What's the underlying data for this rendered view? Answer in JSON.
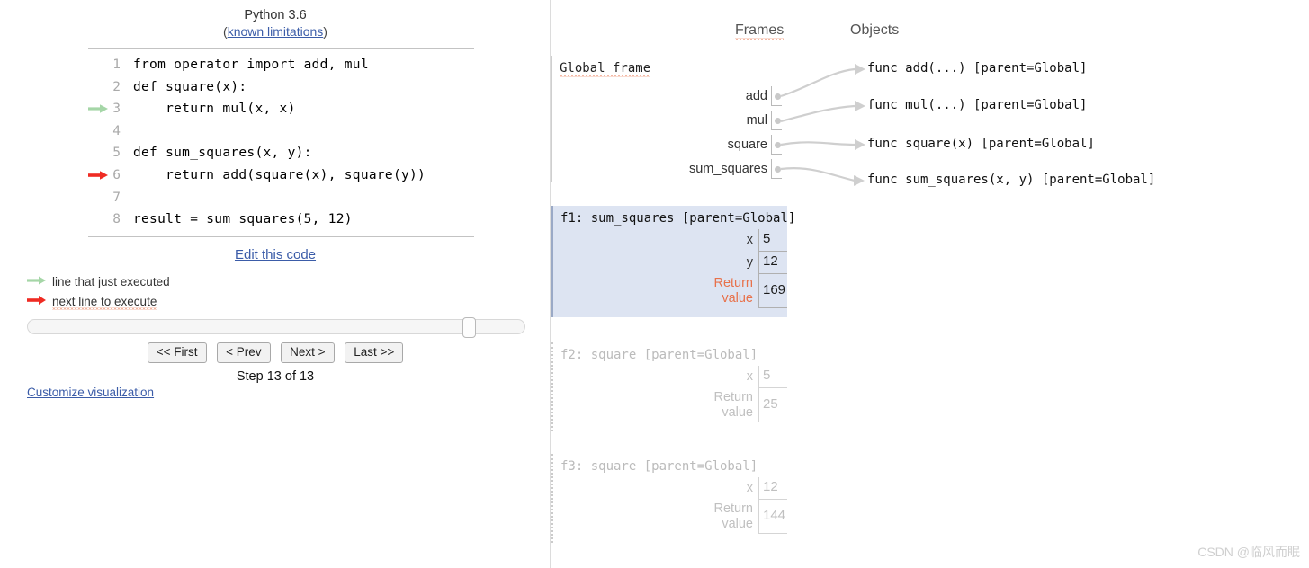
{
  "header": {
    "python_version": "Python 3.6",
    "known_limitations_label": "known limitations",
    "paren_open": "(",
    "paren_close": ")"
  },
  "code": {
    "lines": [
      {
        "number": "1",
        "text": "from operator import add, mul",
        "marker": "none"
      },
      {
        "number": "2",
        "text": "def square(x):",
        "marker": "none"
      },
      {
        "number": "3",
        "text": "    return mul(x, x)",
        "marker": "just-executed"
      },
      {
        "number": "4",
        "text": "",
        "marker": "none"
      },
      {
        "number": "5",
        "text": "def sum_squares(x, y):",
        "marker": "none"
      },
      {
        "number": "6",
        "text": "    return add(square(x), square(y))",
        "marker": "next-to-execute"
      },
      {
        "number": "7",
        "text": "",
        "marker": "none"
      },
      {
        "number": "8",
        "text": "result = sum_squares(5, 12)",
        "marker": "none"
      }
    ]
  },
  "edit_code_label": "Edit this code",
  "legend": {
    "just_executed": "line that just executed",
    "next_to_execute": "next line to execute",
    "green_color": "#a5d6a7",
    "red_color": "#ef2b23"
  },
  "controls": {
    "first_label": "<< First",
    "prev_label": "< Prev",
    "next_label": "Next >",
    "last_label": "Last >>",
    "step_label": "Step 13 of 13",
    "slider_position_percent": 90
  },
  "customize_link_label": "Customize visualization",
  "right": {
    "frames_header": "Frames",
    "objects_header": "Objects",
    "global_frame_label": "Global frame",
    "global_vars": [
      {
        "name": "add"
      },
      {
        "name": "mul"
      },
      {
        "name": "square"
      },
      {
        "name": "sum_squares"
      }
    ],
    "objects": [
      {
        "label": "func add(...) [parent=Global]"
      },
      {
        "label": "func mul(...) [parent=Global]"
      },
      {
        "label": "func square(x) [parent=Global]"
      },
      {
        "label": "func sum_squares(x, y) [parent=Global]"
      }
    ],
    "stack_frames": [
      {
        "title": "f1: sum_squares [parent=Global]",
        "state": "active",
        "vars": [
          {
            "name": "x",
            "value": "5",
            "is_return": false
          },
          {
            "name": "y",
            "value": "12",
            "is_return": false
          },
          {
            "name": "Return\nvalue",
            "value": "169",
            "is_return": true
          }
        ]
      },
      {
        "title": "f2: square [parent=Global]",
        "state": "faded",
        "vars": [
          {
            "name": "x",
            "value": "5",
            "is_return": false
          },
          {
            "name": "Return\nvalue",
            "value": "25",
            "is_return": true
          }
        ]
      },
      {
        "title": "f3: square [parent=Global]",
        "state": "faded",
        "vars": [
          {
            "name": "x",
            "value": "12",
            "is_return": false
          },
          {
            "name": "Return\nvalue",
            "value": "144",
            "is_return": true
          }
        ]
      }
    ]
  },
  "watermark": "CSDN @临风而眠"
}
